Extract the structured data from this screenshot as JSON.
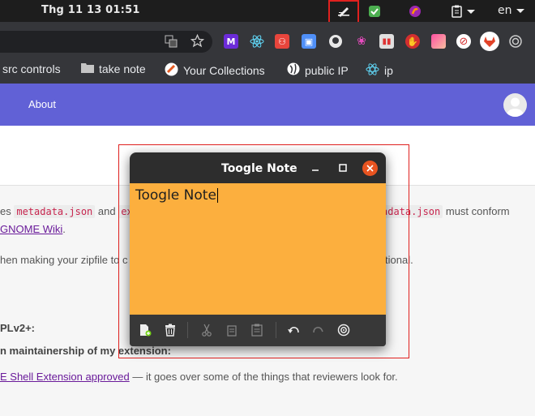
{
  "system_bar": {
    "clock": "Thg 11 13  01:51",
    "language": "en"
  },
  "bookmarks": [
    {
      "label": "src controls",
      "icon": "folder-icon"
    },
    {
      "label": "take note",
      "icon": "folder-icon"
    },
    {
      "label": "Your Collections",
      "icon": "collections-icon"
    },
    {
      "label": "public IP",
      "icon": "globe-icon"
    },
    {
      "label": "ip",
      "icon": "react-icon"
    }
  ],
  "navbar": {
    "about_label": "About"
  },
  "page": {
    "line1_prefix": "es ",
    "line1_code1": "metadata.json",
    "line1_and": " and ",
    "line1_code2": "ex",
    "line1_code3": "adata.json",
    "line1_suffix": " must conform",
    "line2_link": "GNOME Wiki",
    "line2_period": ".",
    "line3_prefix": "hen making your zipfile to c",
    "line3_suffix": "tional.",
    "line4_bold": "PLv2+:",
    "line5_bold": "n maintainership of my extension:",
    "line6_link": "E Shell Extension approved",
    "line6_suffix": " — it goes over some of the things that reviewers look for."
  },
  "note_window": {
    "title": "Toogle Note",
    "content": "Toogle Note"
  },
  "colors": {
    "accent": "#6161d6",
    "note_bg": "#fcaf3e",
    "close": "#e95420",
    "highlight": "#e0211f"
  }
}
